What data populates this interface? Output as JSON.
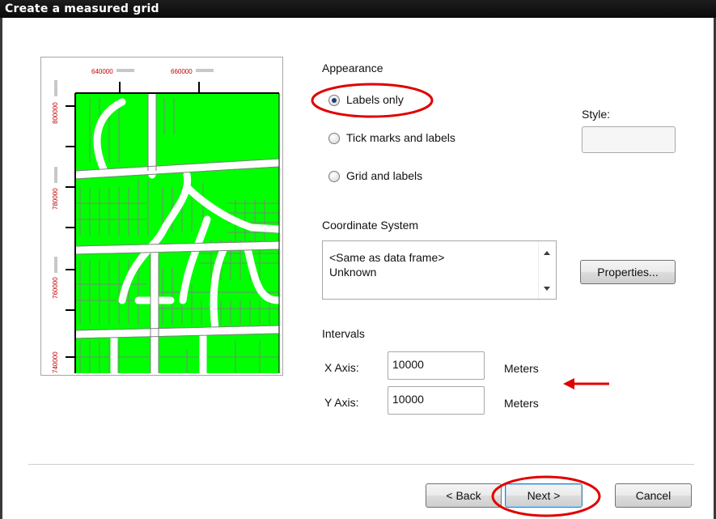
{
  "window": {
    "title": "Create a measured grid"
  },
  "preview": {
    "x_ticks": [
      "640000",
      "660000"
    ],
    "y_ticks": [
      "800000",
      "780000",
      "760000",
      "740000"
    ],
    "colors": {
      "parcel_fill": "#00ff00",
      "parcel_line": "#808080",
      "label": "#c00000"
    }
  },
  "appearance": {
    "title": "Appearance",
    "options": [
      {
        "label": "Labels only",
        "selected": true
      },
      {
        "label": "Tick marks and labels",
        "selected": false
      },
      {
        "label": "Grid and labels",
        "selected": false
      }
    ],
    "style_label": "Style:"
  },
  "coordinate_system": {
    "title": "Coordinate System",
    "lines": [
      "<Same as data frame>",
      "Unknown"
    ],
    "properties_button": "Properties..."
  },
  "intervals": {
    "title": "Intervals",
    "x_label": "X Axis:",
    "x_value": "10000",
    "x_unit": "Meters",
    "y_label": "Y Axis:",
    "y_value": "10000",
    "y_unit": "Meters"
  },
  "buttons": {
    "back": "< Back",
    "next": "Next >",
    "cancel": "Cancel"
  },
  "annotation_color": "#e00000"
}
